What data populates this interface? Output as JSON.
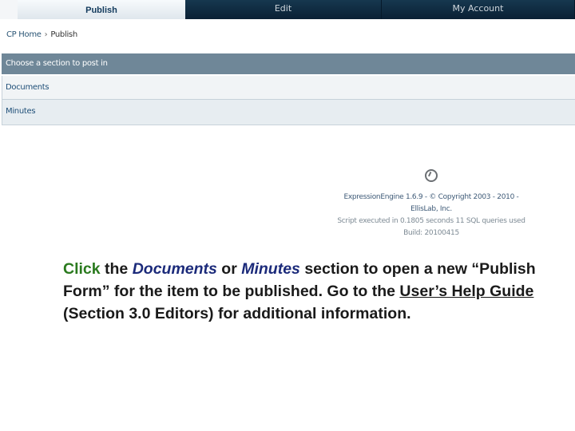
{
  "topnav": {
    "tabs": [
      {
        "label": "Publish",
        "active": true
      },
      {
        "label": "Edit",
        "active": false
      },
      {
        "label": "My Account",
        "active": false
      }
    ]
  },
  "breadcrumb": {
    "home": "CP Home",
    "separator": "›",
    "current": "Publish"
  },
  "sections": {
    "header": "Choose a section to post in",
    "items": [
      "Documents",
      "Minutes"
    ]
  },
  "footer": {
    "line1": "ExpressionEngine 1.6.9 - © Copyright 2003 - 2010 - EllisLab, Inc.",
    "line2": "Script executed in 0.1805 seconds  11 SQL queries used",
    "line3": "Build: 20100415"
  },
  "instructions": {
    "click": "Click",
    "t1": " the ",
    "documents": "Documents",
    "t2": " or ",
    "minutes": "Minutes",
    "t3": " section to open a new “Publish Form” for the item to be published. Go to the ",
    "guide": "User’s Help Guide",
    "t4": " (Section 3.0 Editors) for additional information."
  },
  "colors": {
    "nav_bg": "#0b2a44",
    "section_header_bg": "#6f8798",
    "link": "#1f4f78",
    "instruction_green": "#2a7a1e",
    "instruction_navy": "#1b2a7a"
  }
}
